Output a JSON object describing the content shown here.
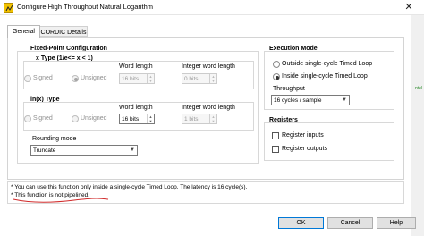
{
  "window": {
    "title": "Configure High Throughput Natural Logarithm"
  },
  "tabs": [
    {
      "label": "General"
    },
    {
      "label": "CORDIC Details"
    }
  ],
  "fixed_point": {
    "title": "Fixed-Point Configuration",
    "x_type": {
      "title": "x Type (1/e<= x < 1)",
      "signed_label": "Signed",
      "unsigned_label": "Unsigned",
      "word_length_label": "Word length",
      "word_length_value": "16 bits",
      "integer_word_length_label": "Integer word length",
      "integer_word_length_value": "0 bits"
    },
    "lnx_type": {
      "title": "ln(x) Type",
      "signed_label": "Signed",
      "unsigned_label": "Unsigned",
      "word_length_label": "Word length",
      "word_length_value": "16 bits",
      "integer_word_length_label": "Integer word length",
      "integer_word_length_value": "1 bits"
    },
    "rounding_mode_label": "Rounding mode",
    "rounding_mode_value": "Truncate"
  },
  "execution_mode": {
    "title": "Execution Mode",
    "outside_label": "Outside single-cycle Timed Loop",
    "inside_label": "Inside single-cycle Timed Loop",
    "selected": "inside",
    "throughput_label": "Throughput",
    "throughput_value": "16 cycles / sample"
  },
  "registers": {
    "title": "Registers",
    "inputs_label": "Register inputs",
    "inputs_checked": false,
    "outputs_label": "Register outputs",
    "outputs_checked": false
  },
  "messages": {
    "line1": "* You can use this function only inside a single-cycle Timed Loop. The latency is 16 cycle(s).",
    "line2": "* This function is not pipelined."
  },
  "buttons": {
    "ok": "OK",
    "cancel": "Cancel",
    "help": "Help"
  },
  "icons": {
    "app": "labview-vi-icon",
    "close": "close-icon"
  },
  "side_fragment": "ntel",
  "colors": {
    "annotation": "#d12b2b",
    "accent": "#0078d7"
  }
}
